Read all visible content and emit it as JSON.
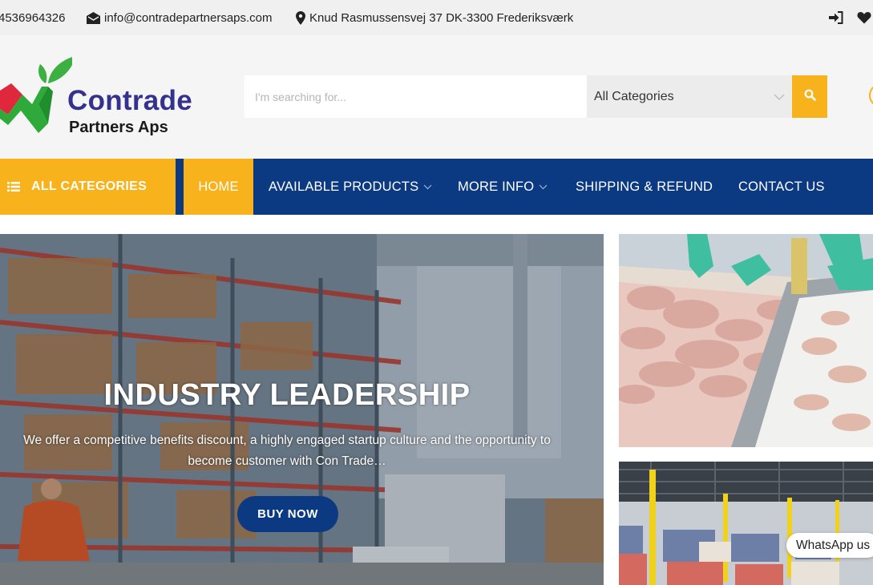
{
  "topbar": {
    "phone": "4536964326",
    "email": "info@contradepartnersaps.com",
    "address": "Knud Rasmussensvej 37 DK-3300 Frederiksværk"
  },
  "logo": {
    "line1": "Contrade",
    "line2": "Partners Aps"
  },
  "search": {
    "placeholder": "I'm searching for...",
    "category_selected": "All Categories"
  },
  "nav": {
    "all_categories": "ALL CATEGORIES",
    "items": [
      {
        "label": "HOME"
      },
      {
        "label": "AVAILABLE PRODUCTS"
      },
      {
        "label": "MORE INFO"
      },
      {
        "label": "SHIPPING & REFUND"
      },
      {
        "label": "CONTACT US"
      }
    ]
  },
  "hero": {
    "title": "INDUSTRY LEADERSHIP",
    "description": "We offer a competitive benefits discount, a highly engaged startup culture and the opportunity to become customer with Con Trade…",
    "button": "BUY NOW"
  },
  "whatsapp": {
    "label": "WhatsApp us"
  },
  "colors": {
    "accent": "#f7b21c",
    "nav_blue": "#0b3a82",
    "brand_purple": "#35318f",
    "brand_green": "#2faa3a",
    "brand_red": "#e0283c"
  }
}
